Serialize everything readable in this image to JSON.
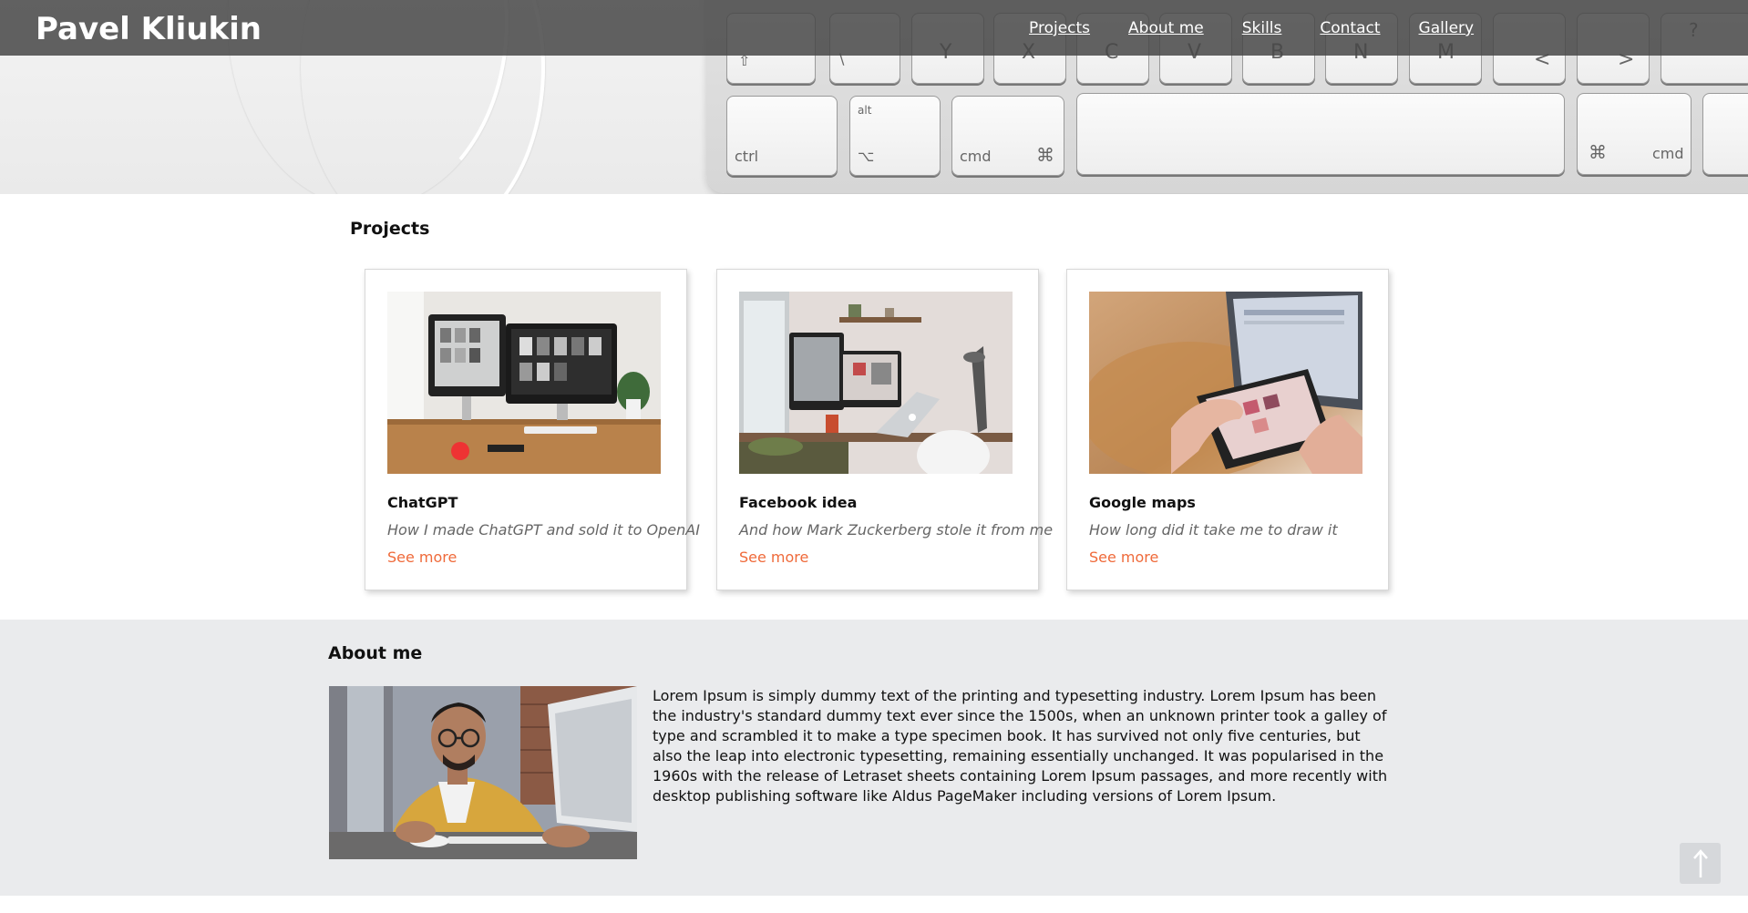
{
  "header": {
    "brand": "Pavel Kliukin",
    "nav": [
      "Projects",
      "About me",
      "Skills",
      "Contact",
      "Gallery"
    ]
  },
  "hero": {
    "keys": [
      "ctrl",
      "alt",
      "⌥",
      "cmd",
      "⌘",
      "⌘",
      "cmd",
      "Y",
      "X",
      "C",
      "V",
      "B",
      "N",
      "M",
      "<",
      ">",
      "?"
    ]
  },
  "projects": {
    "title": "Projects",
    "cards": [
      {
        "title": "ChatGPT",
        "subtitle": "How I made ChatGPT and sold it to OpenAI",
        "more": "See more"
      },
      {
        "title": "Facebook idea",
        "subtitle": "And how Mark Zuckerberg stole it from me",
        "more": "See more"
      },
      {
        "title": "Google maps",
        "subtitle": "How long did it take me to draw it",
        "more": "See more"
      }
    ]
  },
  "about": {
    "title": "About me",
    "text": "Lorem Ipsum is simply dummy text of the printing and typesetting industry. Lorem Ipsum has been the industry's standard dummy text ever since the 1500s, when an unknown printer took a galley of type and scrambled it to make a type specimen book. It has survived not only five centuries, but also the leap into electronic typesetting, remaining essentially unchanged. It was popularised in the 1960s with the release of Letraset sheets containing Lorem Ipsum passages, and more recently with desktop publishing software like Aldus PageMaker including versions of Lorem Ipsum."
  },
  "colors": {
    "accent": "#ef6a3a",
    "topbar": "#464646",
    "about_bg": "#eaebed"
  },
  "icons": {
    "scroll_top": "arrow-up-icon"
  }
}
